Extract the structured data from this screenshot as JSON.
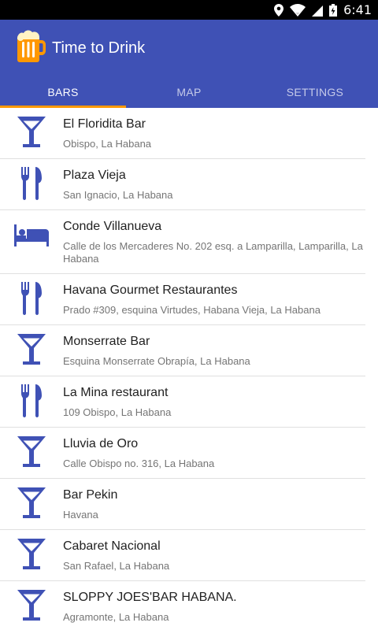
{
  "status_bar": {
    "time": "6:41"
  },
  "app_bar": {
    "title": "Time to Drink"
  },
  "tabs": [
    {
      "label": "BARS",
      "active": true
    },
    {
      "label": "MAP",
      "active": false
    },
    {
      "label": "SETTINGS",
      "active": false
    }
  ],
  "colors": {
    "primary": "#3f51b5",
    "accent": "#ff9800",
    "icon": "#3f51b5"
  },
  "places": [
    {
      "name": "El Floridita Bar",
      "address": "Obispo, La Habana",
      "icon": "cocktail-icon"
    },
    {
      "name": "Plaza Vieja",
      "address": "San Ignacio, La Habana",
      "icon": "restaurant-icon"
    },
    {
      "name": "Conde Villanueva",
      "address": "Calle de los Mercaderes No. 202 esq. a Lamparilla, Lamparilla, La Habana",
      "icon": "hotel-icon"
    },
    {
      "name": "Havana Gourmet Restaurantes",
      "address": "Prado #309, esquina Virtudes, Habana Vieja, La Habana",
      "icon": "restaurant-icon"
    },
    {
      "name": "Monserrate Bar",
      "address": "Esquina Monserrate Obrapía, La Habana",
      "icon": "cocktail-icon"
    },
    {
      "name": "La Mina restaurant",
      "address": "109 Obispo, La Habana",
      "icon": "restaurant-icon"
    },
    {
      "name": "Lluvia de Oro",
      "address": "Calle Obispo no. 316, La Habana",
      "icon": "cocktail-icon"
    },
    {
      "name": "Bar Pekin",
      "address": "Havana",
      "icon": "cocktail-icon"
    },
    {
      "name": "Cabaret Nacional",
      "address": "San Rafael, La Habana",
      "icon": "cocktail-icon"
    },
    {
      "name": "SLOPPY JOES'BAR HABANA.",
      "address": "Agramonte, La Habana",
      "icon": "cocktail-icon"
    }
  ]
}
